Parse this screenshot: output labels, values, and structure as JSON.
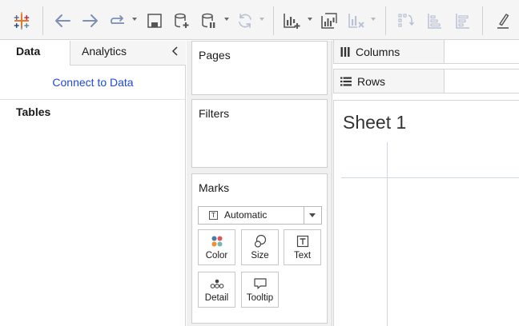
{
  "toolbar": {
    "buttons": [
      {
        "name": "tableau-logo-icon",
        "enabled": true
      },
      {
        "name": "undo-icon",
        "enabled": true
      },
      {
        "name": "redo-icon",
        "enabled": true
      },
      {
        "name": "replay-icon",
        "enabled": true
      },
      {
        "name": "save-icon",
        "enabled": true
      },
      {
        "name": "new-data-source-icon",
        "enabled": true
      },
      {
        "name": "pause-updates-icon",
        "enabled": true
      },
      {
        "name": "refresh-icon",
        "enabled": false
      },
      {
        "name": "new-worksheet-icon",
        "enabled": true
      },
      {
        "name": "duplicate-sheet-icon",
        "enabled": true
      },
      {
        "name": "clear-sheet-icon",
        "enabled": false
      },
      {
        "name": "swap-rows-columns-icon",
        "enabled": false
      },
      {
        "name": "sort-ascending-icon",
        "enabled": false
      },
      {
        "name": "sort-descending-icon",
        "enabled": false
      },
      {
        "name": "highlight-icon",
        "enabled": true
      }
    ]
  },
  "data_pane": {
    "tabs": {
      "data": "Data",
      "analytics": "Analytics"
    },
    "connect_link": "Connect to Data",
    "tables_heading": "Tables"
  },
  "cards": {
    "pages": "Pages",
    "filters": "Filters",
    "marks": "Marks",
    "mark_type": "Automatic",
    "mark_buttons": {
      "color": "Color",
      "size": "Size",
      "text": "Text",
      "detail": "Detail",
      "tooltip": "Tooltip"
    }
  },
  "shelves": {
    "columns": "Columns",
    "rows": "Rows"
  },
  "sheet": {
    "title": "Sheet 1"
  },
  "colors": {
    "link": "#1f49d6",
    "color_dots": [
      "#4e79a7",
      "#f28e2b",
      "#e15759",
      "#76b7b2"
    ]
  }
}
